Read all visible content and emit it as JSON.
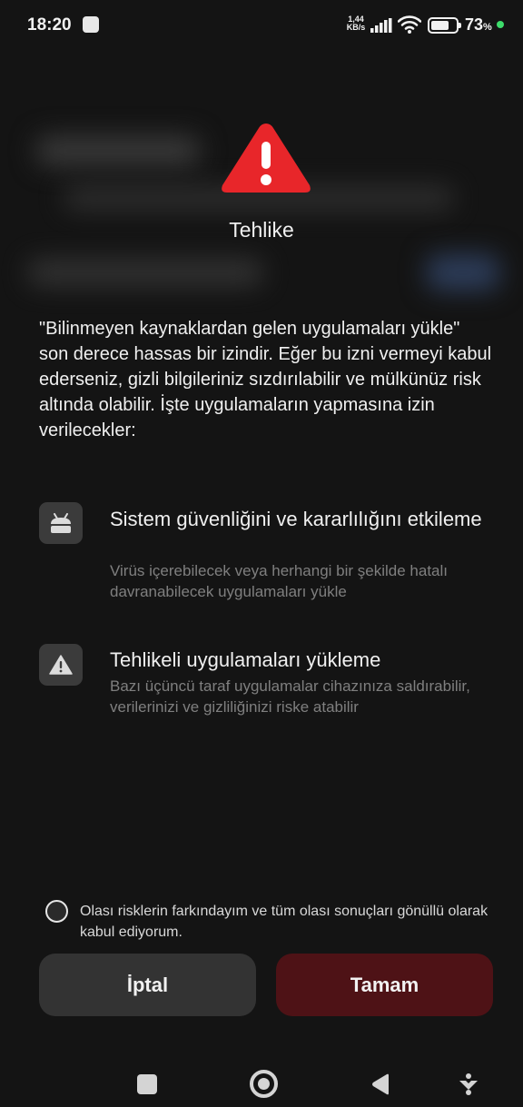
{
  "status_bar": {
    "time": "18:20",
    "net_speed_value": "1,44",
    "net_speed_unit": "KB/s",
    "battery_percent": "73",
    "battery_percent_sign": "%",
    "battery_level": 0.73,
    "charge_dot_color": "#3ddc6b",
    "icons": [
      "notification-icon",
      "signal-icon",
      "wifi-icon",
      "battery-icon"
    ]
  },
  "dialog": {
    "warning_icon": "warning-triangle-icon",
    "warning_color": "#e8262a",
    "title": "Tehlike",
    "intro": "\"Bilinmeyen kaynaklardan gelen uygulamaları yükle\" son derece hassas bir izindir. Eğer bu izni vermeyi kabul ederseniz, gizli bilgileriniz sızdırılabilir ve mülkünüz risk altında olabilir. İşte uygulamaların yapmasına izin verilecekler:",
    "permissions": [
      {
        "icon": "android-icon",
        "title": "Sistem güvenliğini ve kararlılığını etkileme",
        "description": "Virüs içerebilecek veya herhangi bir şekilde hatalı davranabilecek uygulamaları yükle"
      },
      {
        "icon": "warning-icon",
        "title": "Tehlikeli uygulamaları yükleme",
        "description": "Bazı üçüncü taraf uygulamalar cihazınıza saldırabilir, verilerinizi ve gizliliğinizi riske atabilir"
      }
    ],
    "consent_text": "Olası risklerin farkındayım ve tüm olası sonuçları gönüllü olarak kabul ediyorum.",
    "consent_checked": false,
    "cancel_label": "İptal",
    "ok_label": "Tamam",
    "ok_color": "#4e1216"
  },
  "nav_bar": {
    "icons": [
      "recents-icon",
      "home-icon",
      "back-icon",
      "accessibility-icon"
    ]
  }
}
